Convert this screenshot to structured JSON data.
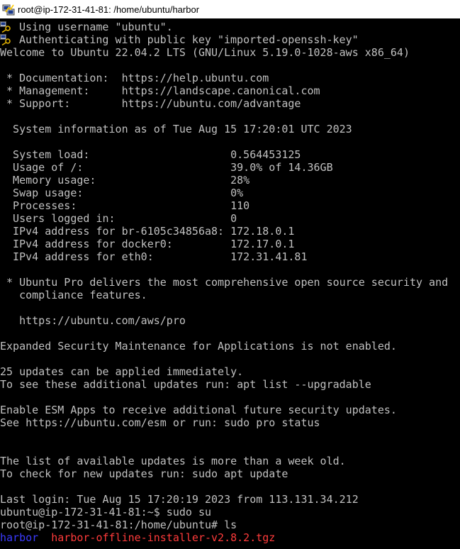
{
  "window": {
    "title": "root@ip-172-31-41-81: /home/ubuntu/harbor",
    "icon": "putty-icon"
  },
  "terminal": {
    "colors": {
      "background": "#000000",
      "foreground": "#c0c0c0",
      "directory": "#3b3bff",
      "archive": "#ff3b3b"
    },
    "lines": [
      "Using username \"ubuntu\".",
      "Authenticating with public key \"imported-openssh-key\"",
      "Welcome to Ubuntu 22.04.2 LTS (GNU/Linux 5.19.0-1028-aws x86_64)",
      "",
      " * Documentation:  https://help.ubuntu.com",
      " * Management:     https://landscape.canonical.com",
      " * Support:        https://ubuntu.com/advantage",
      "",
      "  System information as of Tue Aug 15 17:20:01 UTC 2023",
      "",
      "  System load:                      0.564453125",
      "  Usage of /:                       39.0% of 14.36GB",
      "  Memory usage:                     28%",
      "  Swap usage:                       0%",
      "  Processes:                        110",
      "  Users logged in:                  0",
      "  IPv4 address for br-6105c34856a8: 172.18.0.1",
      "  IPv4 address for docker0:         172.17.0.1",
      "  IPv4 address for eth0:            172.31.41.81",
      "",
      " * Ubuntu Pro delivers the most comprehensive open source security and",
      "   compliance features.",
      "",
      "   https://ubuntu.com/aws/pro",
      "",
      "Expanded Security Maintenance for Applications is not enabled.",
      "",
      "25 updates can be applied immediately.",
      "To see these additional updates run: apt list --upgradable",
      "",
      "Enable ESM Apps to receive additional future security updates.",
      "See https://ubuntu.com/esm or run: sudo pro status",
      "",
      "",
      "The list of available updates is more than a week old.",
      "To check for new updates run: sudo apt update",
      "",
      "Last login: Tue Aug 15 17:20:19 2023 from 113.131.34.212",
      "ubuntu@ip-172-31-41-81:~$ sudo su",
      "root@ip-172-31-41-81:/home/ubuntu# ls"
    ],
    "ls_output": {
      "directory": "harbor",
      "archive": "harbor-offline-installer-v2.8.2.tgz"
    }
  }
}
